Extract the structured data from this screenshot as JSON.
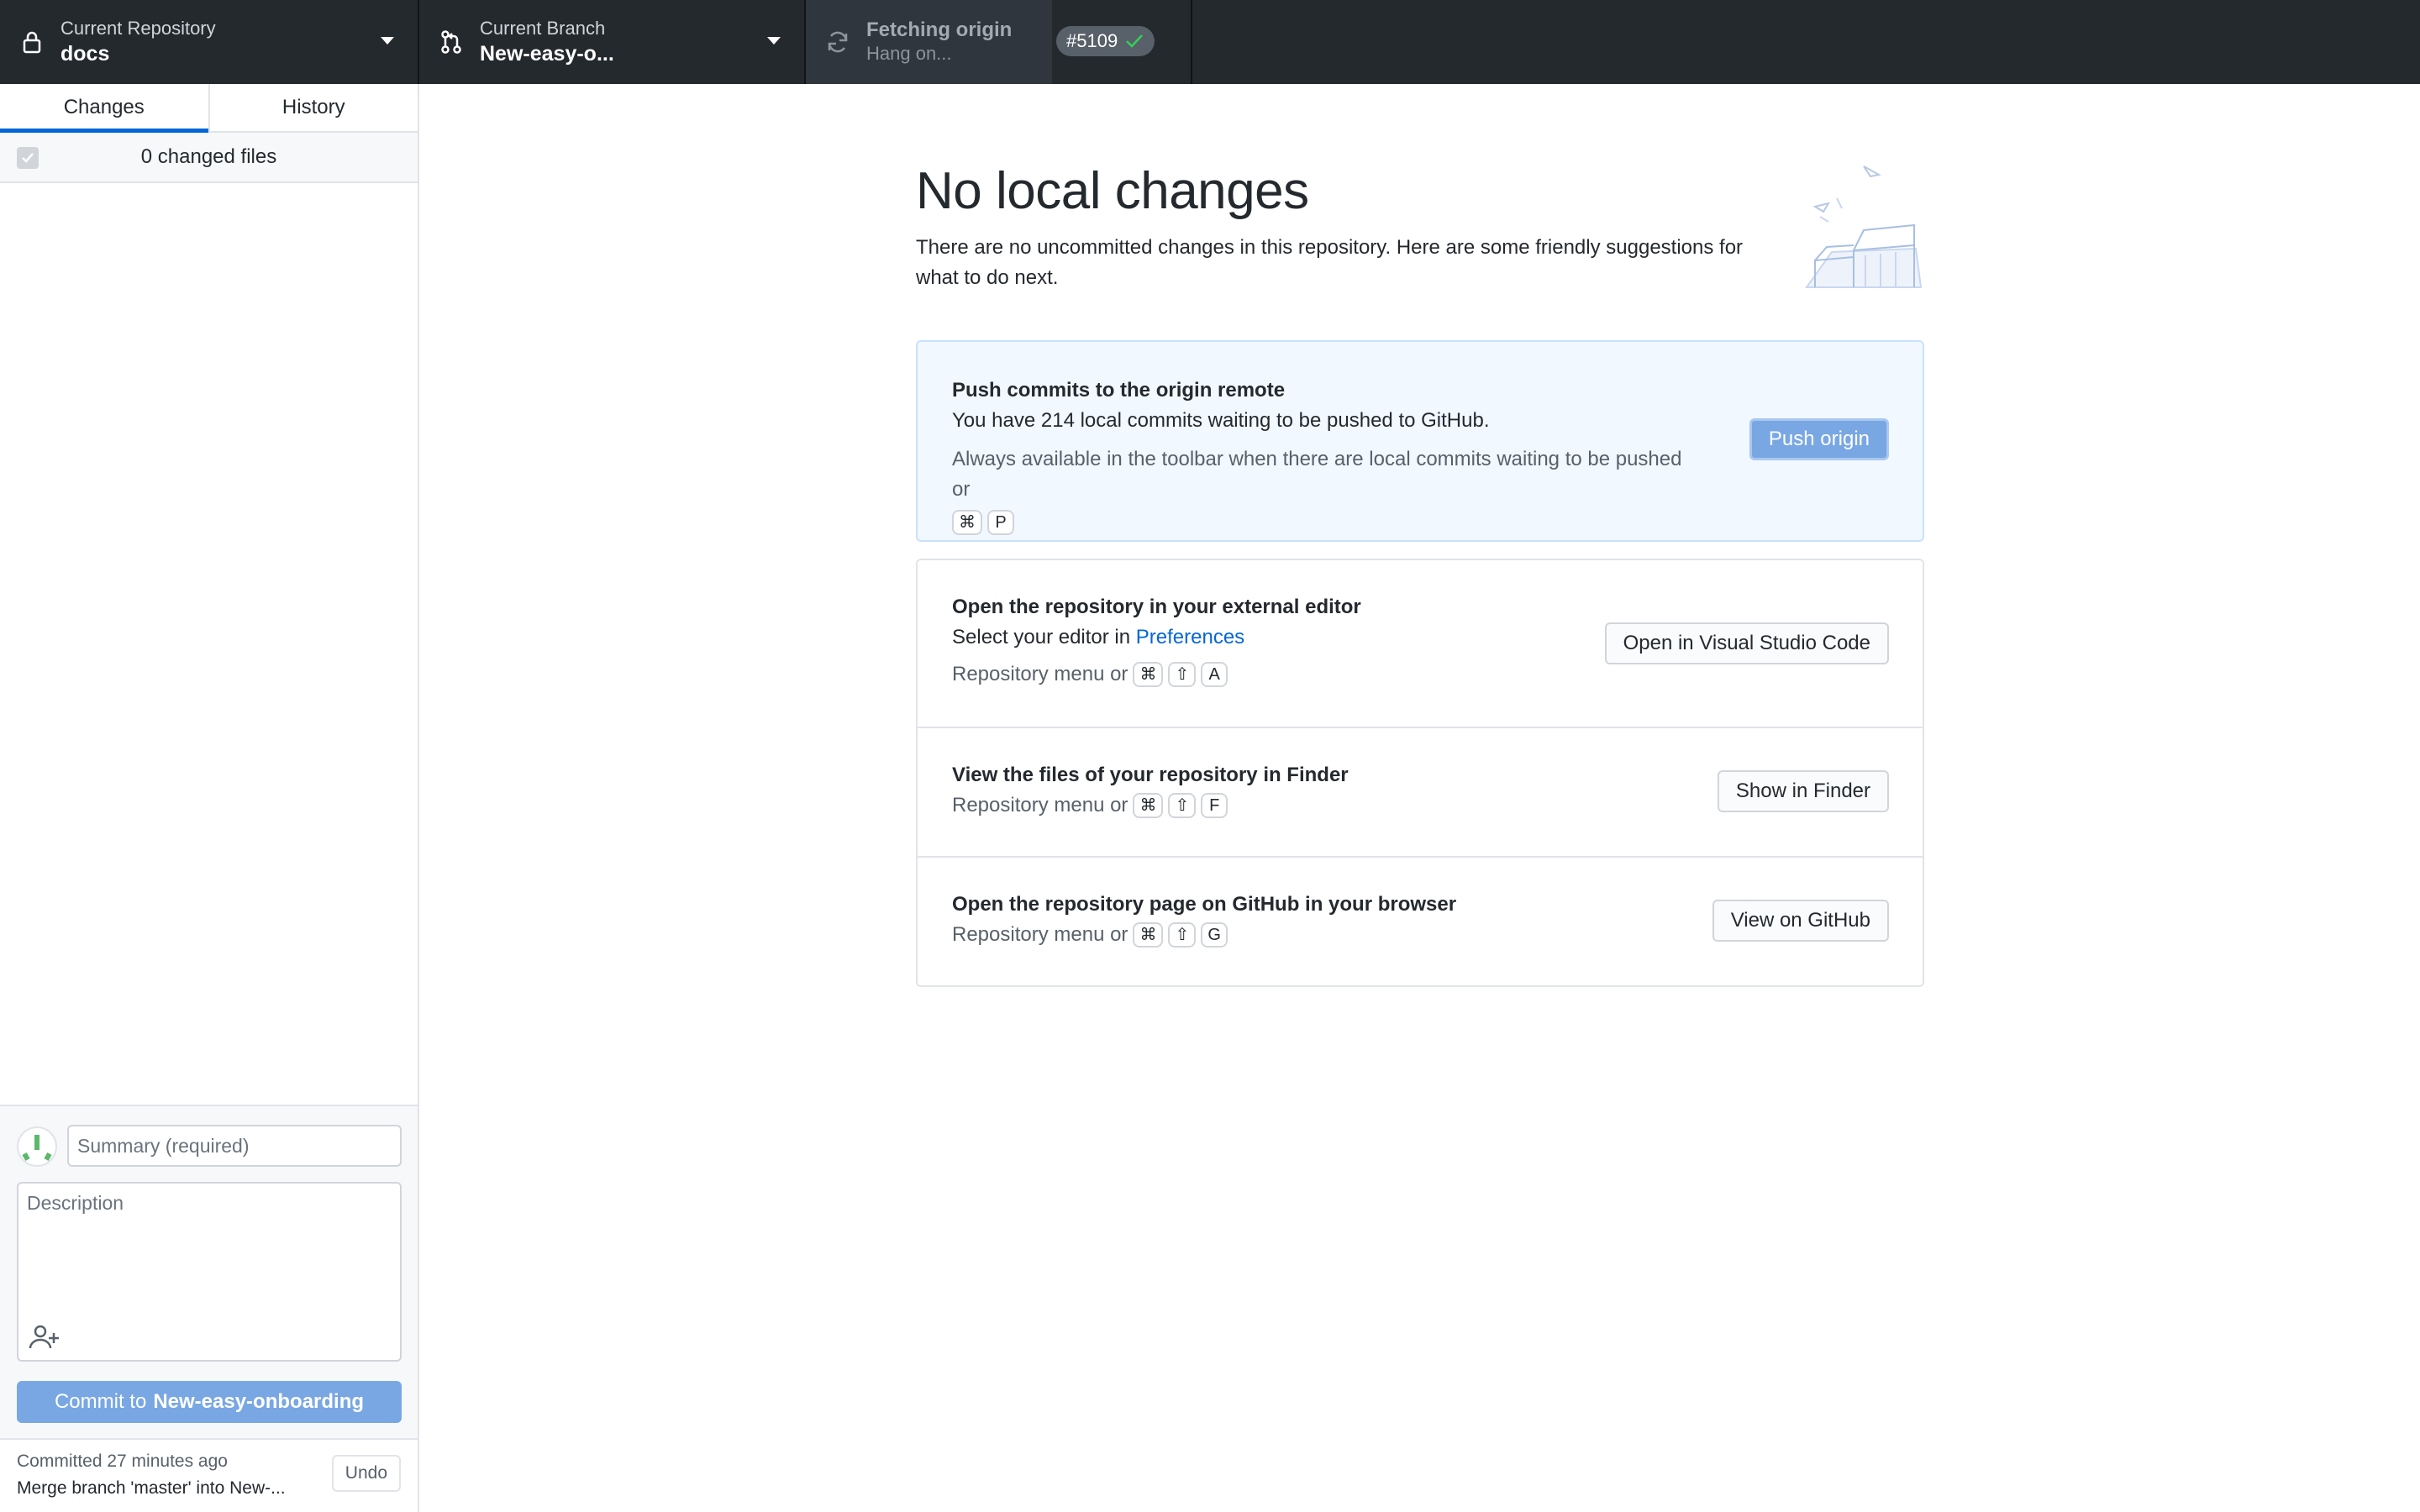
{
  "toolbar": {
    "repository": {
      "label": "Current Repository",
      "value": "docs",
      "icon": "lock-icon"
    },
    "branch": {
      "label": "Current Branch",
      "value": "New-easy-o...",
      "pr_number": "#5109",
      "icon": "git-branch-icon"
    },
    "fetch": {
      "label": "Fetching origin",
      "sub": "Hang on...",
      "icon": "sync-icon"
    }
  },
  "sidebar": {
    "tabs": [
      {
        "label": "Changes",
        "active": true
      },
      {
        "label": "History",
        "active": false
      }
    ],
    "changed_files": "0 changed files",
    "commit": {
      "summary_placeholder": "Summary (required)",
      "description_placeholder": "Description",
      "button_prefix": "Commit to",
      "button_branch": "New-easy-onboarding"
    },
    "last_commit": {
      "time": "Committed 27 minutes ago",
      "message": "Merge branch 'master' into New-...",
      "undo_label": "Undo"
    }
  },
  "main": {
    "title": "No local changes",
    "subtitle": "There are no uncommitted changes in this repository. Here are some friendly suggestions for what to do next.",
    "push": {
      "title": "Push commits to the origin remote",
      "desc": "You have 214 local commits waiting to be pushed to GitHub.",
      "hint": "Always available in the toolbar when there are local commits waiting to be pushed or",
      "keys": [
        "⌘",
        "P"
      ],
      "button": "Push origin"
    },
    "editor": {
      "title": "Open the repository in your external editor",
      "desc_prefix": "Select your editor in",
      "desc_link": "Preferences",
      "hint": "Repository menu or",
      "keys": [
        "⌘",
        "⇧",
        "A"
      ],
      "button": "Open in Visual Studio Code"
    },
    "finder": {
      "title": "View the files of your repository in Finder",
      "hint": "Repository menu or",
      "keys": [
        "⌘",
        "⇧",
        "F"
      ],
      "button": "Show in Finder"
    },
    "github": {
      "title": "Open the repository page on GitHub in your browser",
      "hint": "Repository menu or",
      "keys": [
        "⌘",
        "⇧",
        "G"
      ],
      "button": "View on GitHub"
    }
  },
  "colors": {
    "toolbar_bg": "#24292e",
    "accent": "#0366d6",
    "primary_button": "#79a7e3",
    "push_card_bg": "#f1f8ff"
  }
}
